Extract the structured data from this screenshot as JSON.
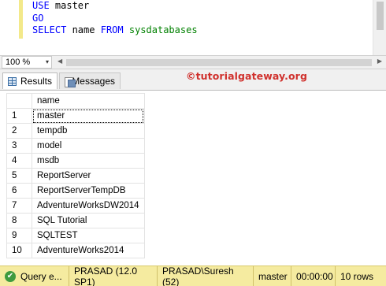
{
  "editor": {
    "line1": {
      "kw": "USE",
      "rest": " master"
    },
    "line2": {
      "kw": "GO"
    },
    "line3": {
      "kw1": "SELECT",
      "mid": " name ",
      "kw2": "FROM",
      "sp": " ",
      "obj": "sysdatabases"
    }
  },
  "zoom": {
    "value": "100 %",
    "arrow": "▾"
  },
  "tabs": {
    "results": "Results",
    "messages": "Messages"
  },
  "watermark": "©tutorialgateway.org",
  "grid": {
    "column": "name",
    "rows": [
      {
        "n": "1",
        "v": "master"
      },
      {
        "n": "2",
        "v": "tempdb"
      },
      {
        "n": "3",
        "v": "model"
      },
      {
        "n": "4",
        "v": "msdb"
      },
      {
        "n": "5",
        "v": "ReportServer"
      },
      {
        "n": "6",
        "v": "ReportServerTempDB"
      },
      {
        "n": "7",
        "v": "AdventureWorksDW2014"
      },
      {
        "n": "8",
        "v": "SQL Tutorial"
      },
      {
        "n": "9",
        "v": "SQLTEST"
      },
      {
        "n": "10",
        "v": "AdventureWorks2014"
      }
    ]
  },
  "status": {
    "query": "Query e...",
    "server": "PRASAD (12.0 SP1)",
    "user": "PRASAD\\Suresh (52)",
    "database": "master",
    "time": "00:00:00",
    "rows": "10 rows",
    "ok_icon": "✔"
  },
  "colors": {
    "keyword": "#0000ff",
    "object": "#008000",
    "statusbar": "#f5eba0",
    "watermark": "#d0312d"
  }
}
